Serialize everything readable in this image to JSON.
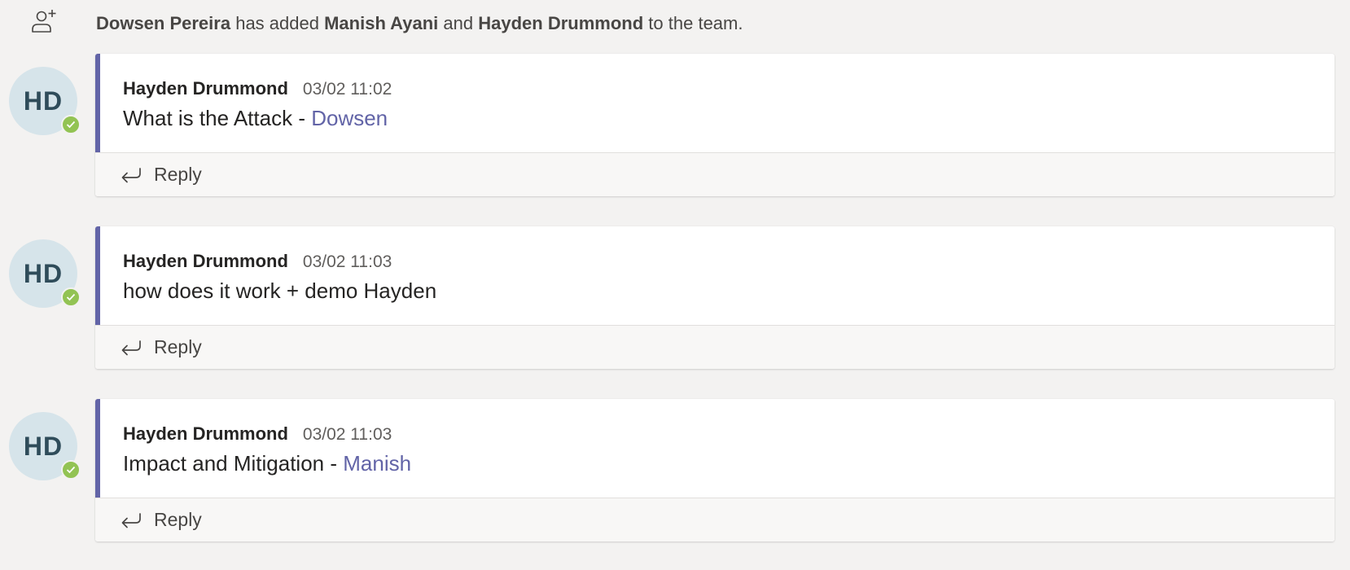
{
  "system_message": {
    "actor": "Dowsen Pereira",
    "text_added": "has added",
    "member1": "Manish Ayani",
    "text_and": "and",
    "member2": "Hayden Drummond",
    "text_suffix": "to the team.",
    "icon": "add-person-icon"
  },
  "colors": {
    "accent": "#6264a7",
    "presence_available": "#92c353",
    "avatar_bg": "#d6e4ea",
    "background": "#f3f2f1"
  },
  "threads": [
    {
      "avatar_initials": "HD",
      "presence": "available",
      "author": "Hayden Drummond",
      "timestamp": "03/02 11:02",
      "body_text": "What is the Attack - ",
      "mention": "Dowsen",
      "reply_label": "Reply",
      "reply_icon": "reply-arrow-icon"
    },
    {
      "avatar_initials": "HD",
      "presence": "available",
      "author": "Hayden Drummond",
      "timestamp": "03/02 11:03",
      "body_text": "how does it work + demo Hayden",
      "mention": "",
      "reply_label": "Reply",
      "reply_icon": "reply-arrow-icon"
    },
    {
      "avatar_initials": "HD",
      "presence": "available",
      "author": "Hayden Drummond",
      "timestamp": "03/02 11:03",
      "body_text": "Impact and Mitigation - ",
      "mention": "Manish",
      "reply_label": "Reply",
      "reply_icon": "reply-arrow-icon"
    }
  ]
}
